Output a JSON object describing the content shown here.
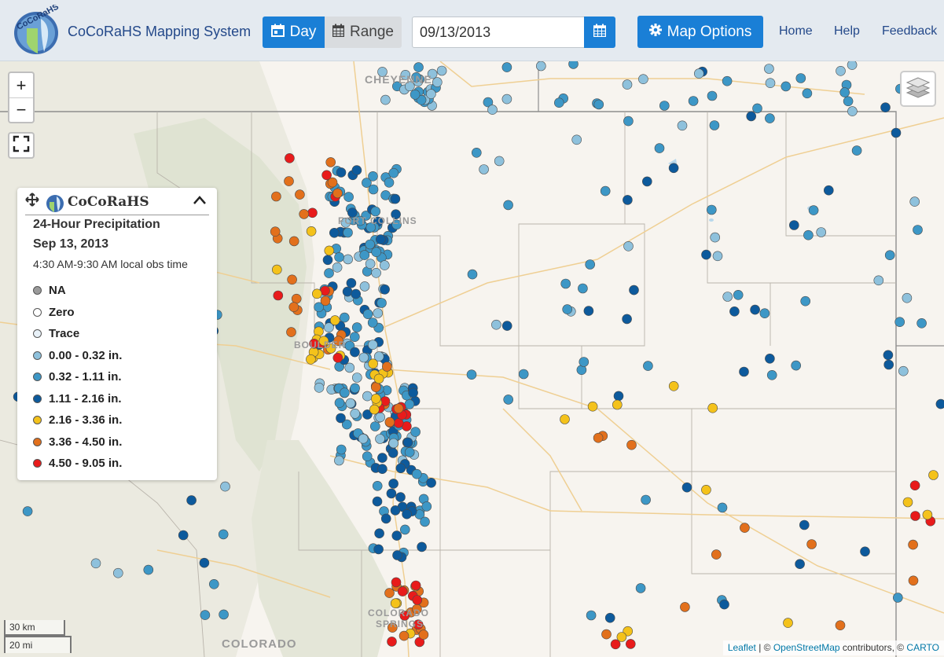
{
  "app": {
    "title": "CoCoRaHS Mapping System",
    "logo_text": "CoCoRaHS"
  },
  "toolbar": {
    "day_label": "Day",
    "range_label": "Range",
    "date_value": "09/13/2013",
    "map_options_label": "Map Options"
  },
  "nav": {
    "home": "Home",
    "help": "Help",
    "feedback": "Feedback"
  },
  "map_controls": {
    "zoom_in": "+",
    "zoom_out": "−"
  },
  "legend": {
    "title": "CoCoRaHS",
    "heading": "24-Hour Precipitation",
    "date": "Sep 13, 2013",
    "obs_time": "4:30 AM-9:30 AM local obs time",
    "entries": [
      {
        "label": "NA",
        "color": "#9a9a9a"
      },
      {
        "label": "Zero",
        "color": "#ffffff"
      },
      {
        "label": "Trace",
        "color": "#e8f1f8"
      },
      {
        "label": "0.00 - 0.32 in.",
        "color": "#8ec1dc"
      },
      {
        "label": "0.32 - 1.11 in.",
        "color": "#3d97c6"
      },
      {
        "label": "1.11 - 2.16 in.",
        "color": "#0d5a9c"
      },
      {
        "label": "2.16 - 3.36 in.",
        "color": "#f4c21b"
      },
      {
        "label": "3.36 - 4.50 in.",
        "color": "#e2701c"
      },
      {
        "label": "4.50 - 9.05 in.",
        "color": "#e81b1b"
      }
    ]
  },
  "map_labels": {
    "cheyenne": "CHEYENNE",
    "fort_collins": "FORT COLLINS",
    "boulder": "BOULDER",
    "colorado_springs_1": "COLORADO",
    "colorado_springs_2": "SPRINGS",
    "state": "COLORADO"
  },
  "scale": {
    "km": "30 km",
    "mi": "20 mi"
  },
  "attribution": {
    "leaflet": "Leaflet",
    "sep1": " | © ",
    "osm": "OpenStreetMap",
    "contrib": " contributors, © ",
    "carto": "CARTO"
  }
}
